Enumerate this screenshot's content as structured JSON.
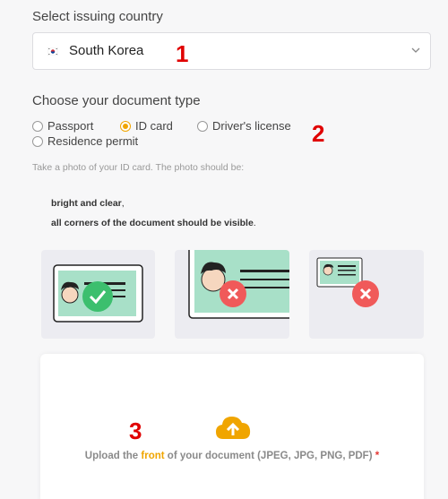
{
  "country": {
    "label": "Select issuing country",
    "selected": "South Korea",
    "flag_icon": "south-korea-flag-icon",
    "dropdown_icon": "chevron-down-icon"
  },
  "annotations": {
    "one": "1",
    "two": "2",
    "three": "3"
  },
  "document_type": {
    "label": "Choose your document type",
    "options": [
      "Passport",
      "ID card",
      "Driver's license",
      "Residence permit"
    ],
    "selected": "ID card"
  },
  "photo_hint": "Take a photo of your ID card. The photo should be:",
  "conditions": {
    "c1_bold": "bright and clear",
    "c1_rest": ",",
    "c2_bold": "all corners of the document should be visible",
    "c2_rest": "."
  },
  "examples": [
    {
      "name": "correct-example",
      "icon": "check-icon"
    },
    {
      "name": "cropped-example",
      "icon": "cross-icon"
    },
    {
      "name": "too-small-example",
      "icon": "cross-icon"
    }
  ],
  "upload": {
    "prefix": "Upload the ",
    "highlight": "front",
    "suffix": " of your document (JPEG, JPG, PNG, PDF) ",
    "required_mark": "*",
    "icon": "cloud-upload-icon"
  },
  "colors": {
    "accent": "#f0a500",
    "card_green": "#a8e0c8",
    "ok_green": "#3cbf6e",
    "error_red": "#f05a5a",
    "annotation_red": "#e00000"
  }
}
